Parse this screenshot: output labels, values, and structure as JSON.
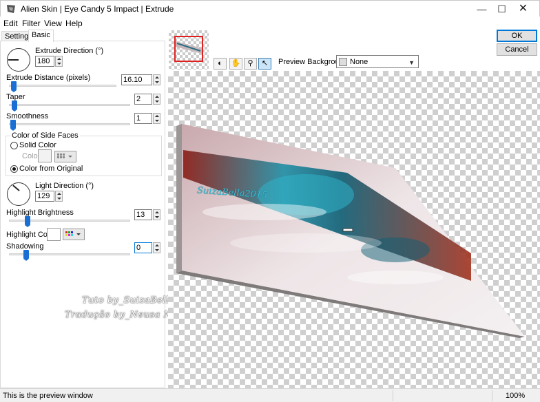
{
  "window": {
    "title": "Alien Skin | Eye Candy 5 Impact | Extrude"
  },
  "menu": [
    "Edit",
    "Filter",
    "View",
    "Help"
  ],
  "tabs": [
    {
      "label": "Settings"
    },
    {
      "label": "Basic",
      "active": true
    }
  ],
  "controls": {
    "extrude_direction": {
      "label": "Extrude Direction (°)",
      "value": "180"
    },
    "extrude_distance": {
      "label": "Extrude Distance (pixels)",
      "value": "16.10"
    },
    "taper": {
      "label": "Taper",
      "value": "2"
    },
    "smoothness": {
      "label": "Smoothness",
      "value": "1"
    },
    "side_faces": {
      "group_label": "Color of Side Faces",
      "solid_color": "Solid Color",
      "color_label": "Color",
      "from_original": "Color from Original",
      "selected": "from_original"
    },
    "light_direction": {
      "label": "Light Direction (°)",
      "value": "129"
    },
    "highlight_brightness": {
      "label": "Highlight Brightness",
      "value": "13"
    },
    "highlight_color": {
      "label": "Highlight Color"
    },
    "shadowing": {
      "label": "Shadowing",
      "value": "0"
    }
  },
  "watermark": {
    "line1": "Tuto by_SuizaBella",
    "line2": "Tradução by_Neusa Novaes"
  },
  "toolbar": {
    "preview_background_label": "Preview Background:",
    "preview_background_value": "None"
  },
  "buttons": {
    "ok": "OK",
    "cancel": "Cancel"
  },
  "preview_signature": "SuizaBella2015",
  "status": {
    "text": "This is the preview window",
    "zoom": "100%"
  }
}
